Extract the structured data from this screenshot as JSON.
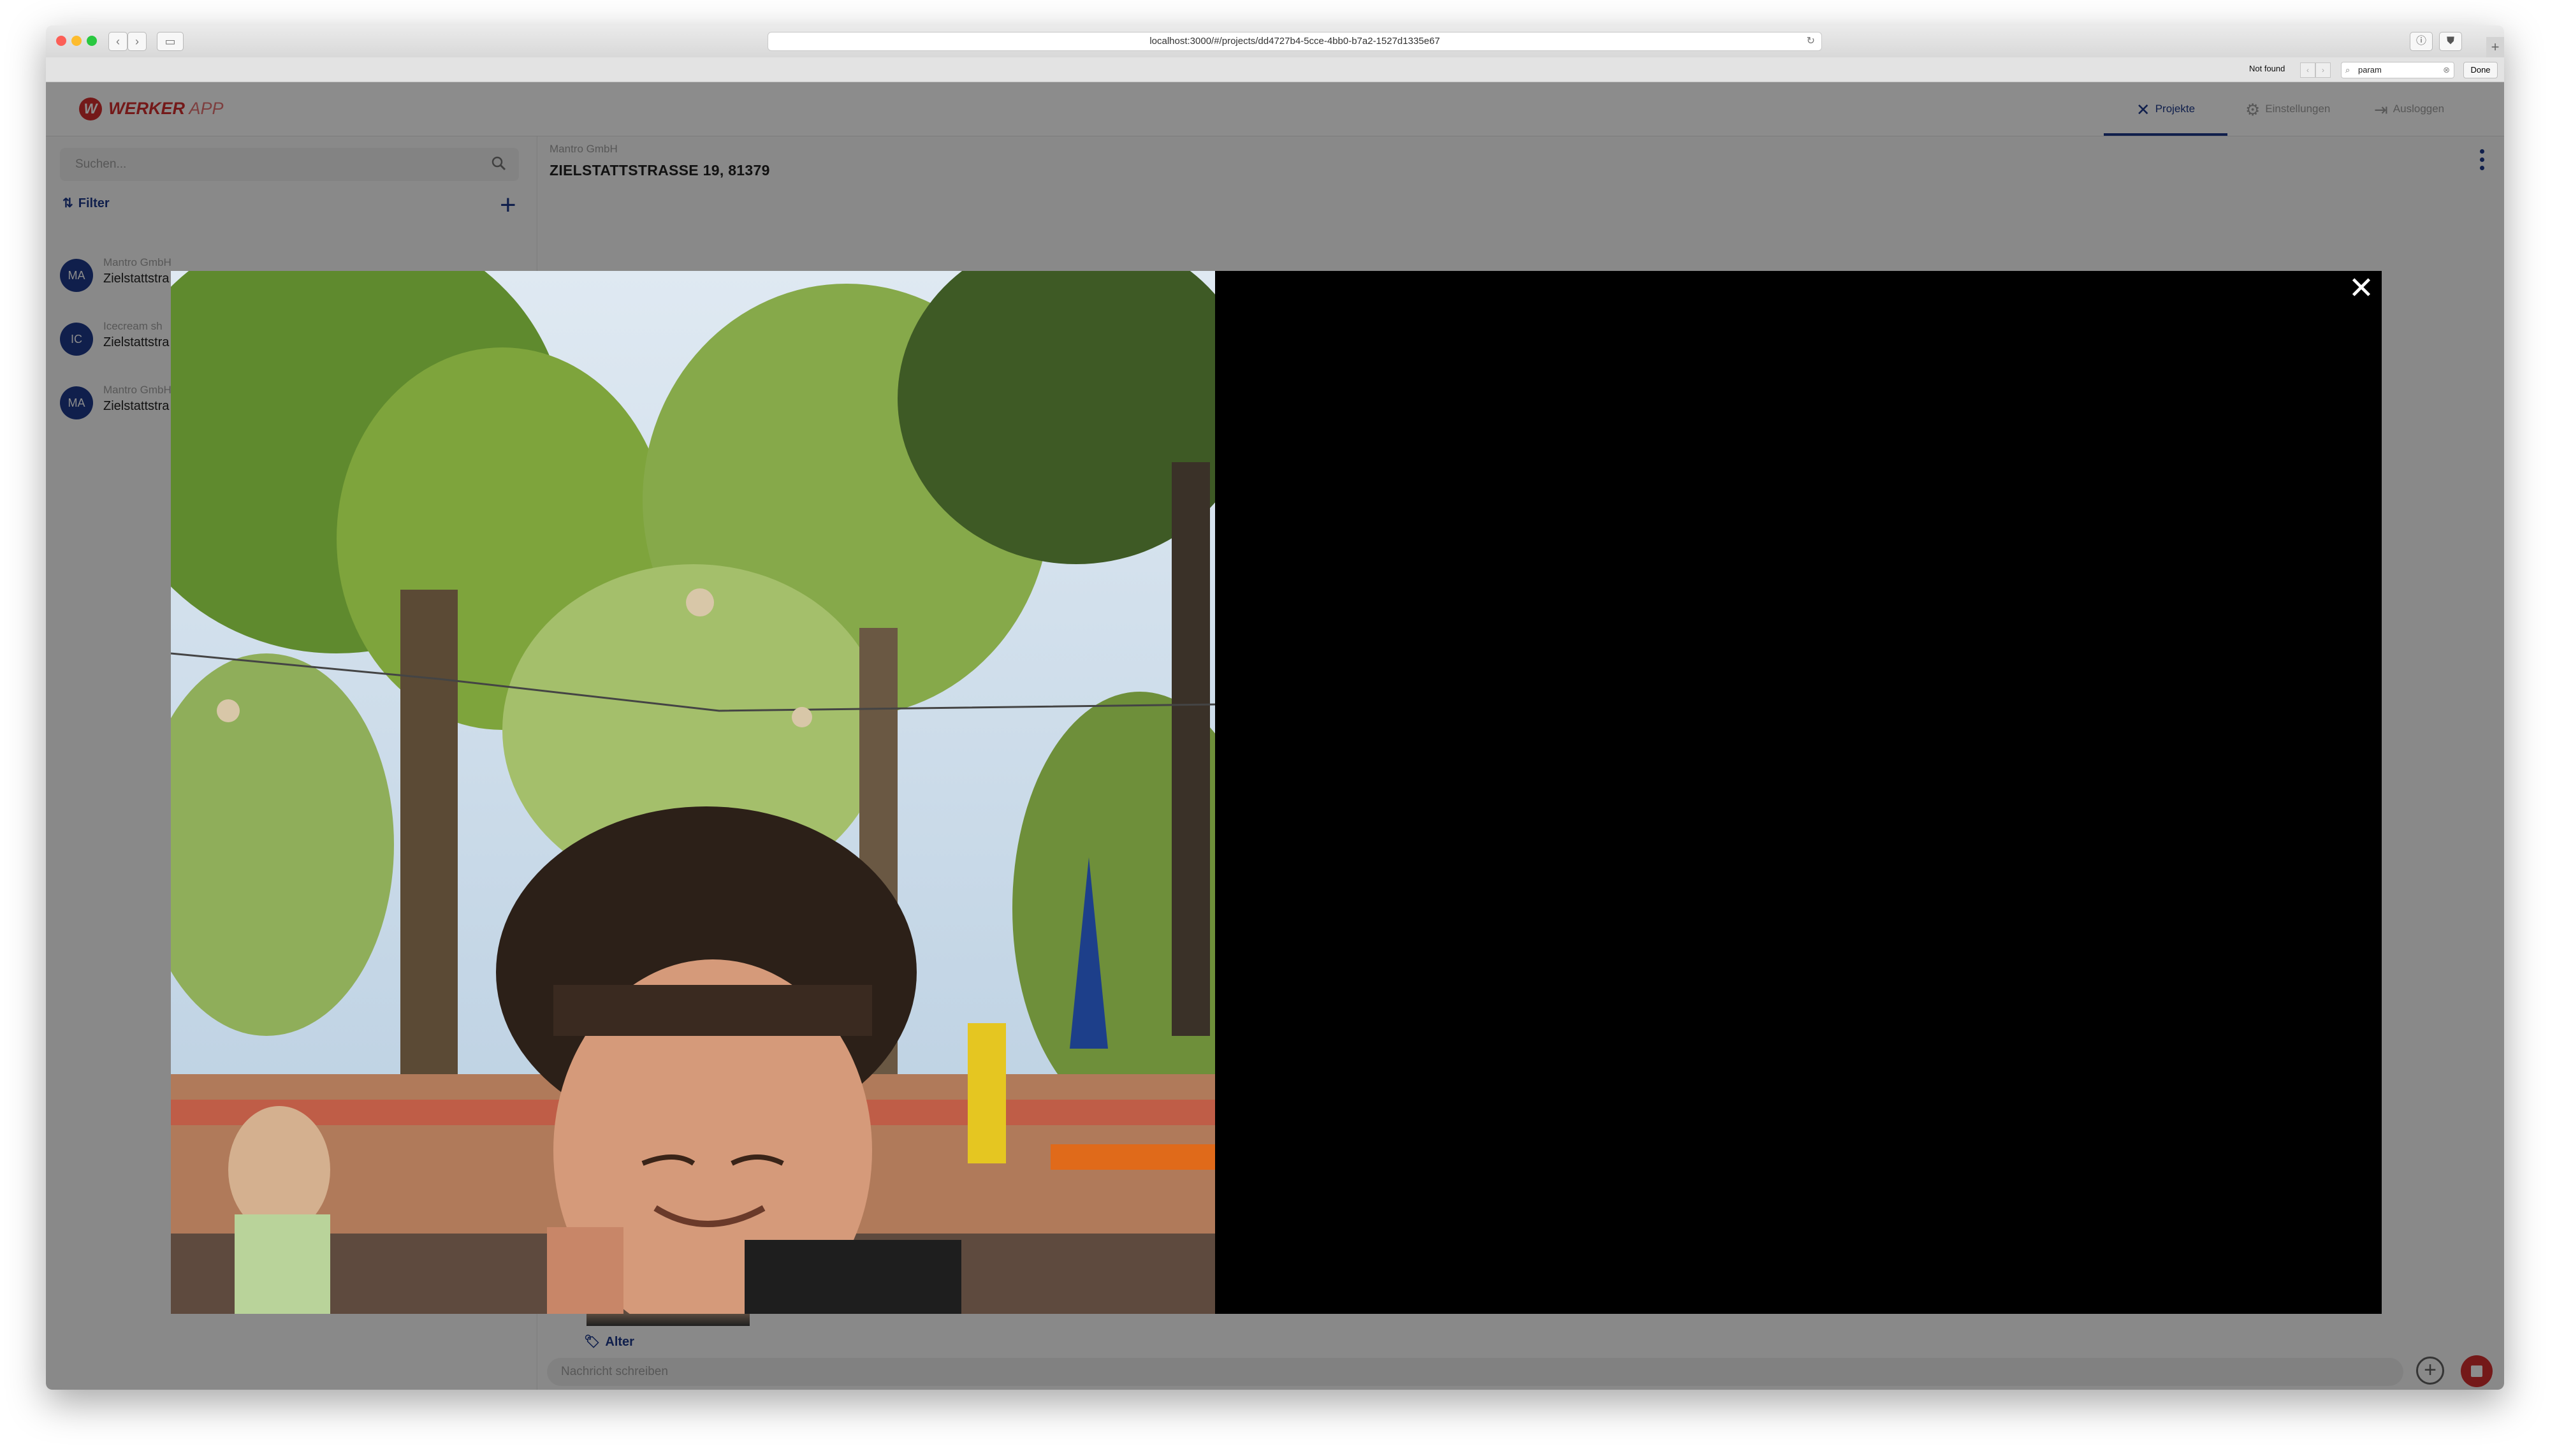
{
  "browser": {
    "url": "localhost:3000/#/projects/dd4727b4-5cce-4bb0-b7a2-1527d1335e67",
    "find": {
      "status": "Not found",
      "query": "param",
      "done_label": "Done"
    }
  },
  "app": {
    "logo": {
      "word1": "WERKER",
      "word2": " APP"
    },
    "nav": [
      {
        "label": "Projekte",
        "icon": "tools-icon",
        "active": true
      },
      {
        "label": "Einstellungen",
        "icon": "gear-icon",
        "active": false
      },
      {
        "label": "Ausloggen",
        "icon": "logout-icon",
        "active": false
      }
    ]
  },
  "sidebar": {
    "search_placeholder": "Suchen...",
    "filter_label": "Filter",
    "projects": [
      {
        "initials": "MA",
        "company": "Mantro GmbH",
        "address": "Zielstattstra"
      },
      {
        "initials": "IC",
        "company": "Icecream sh",
        "address": "Zielstattstra"
      },
      {
        "initials": "MA",
        "company": "Mantro GmbH",
        "address": "Zielstattstra"
      }
    ]
  },
  "project": {
    "company": "Mantro GmbH",
    "address": "ZIELSTATTSTRASSE 19, 81379",
    "tag": "Alter",
    "message_placeholder": "Nachricht schreiben"
  },
  "colors": {
    "brand_red": "#d32f2f",
    "primary_blue": "#1e3a8a"
  },
  "lightbox": {
    "close_icon": "close-icon"
  }
}
